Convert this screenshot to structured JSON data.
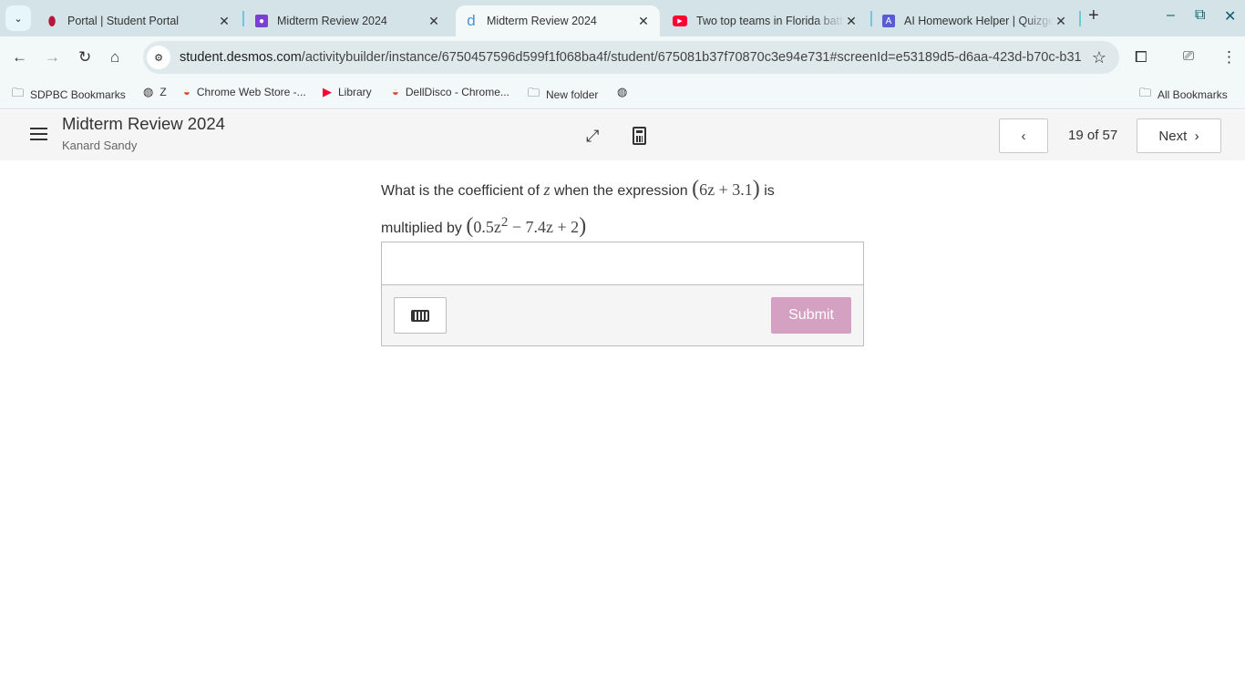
{
  "browser": {
    "tabs": [
      {
        "title": "Portal | Student Portal",
        "icon": "portal-icon",
        "color": "#b4173a"
      },
      {
        "title": "Midterm Review 2024",
        "icon": "classroom-icon",
        "color": "#7b3fd4"
      },
      {
        "title": "Midterm Review 2024",
        "icon": "desmos-icon",
        "color": "#4a90d9",
        "active": true
      },
      {
        "title": "Two top teams in Florida battle",
        "icon": "youtube-icon",
        "color": "#ff0033"
      },
      {
        "title": "AI Homework Helper | Quizgecko",
        "icon": "quizgecko-icon",
        "color": "#5b5bd6"
      }
    ],
    "url_domain": "student.desmos.com",
    "url_path": "/activitybuilder/instance/6750457596d599f1f068ba4f/student/675081b37f70870c3e94e731#screenId=e53189d5-d6aa-423d-b70c-b31…",
    "bookmarks": [
      {
        "label": "SDPBC Bookmarks",
        "icon": "folder-settings-icon"
      },
      {
        "label": "Z",
        "icon": "globe-icon"
      },
      {
        "label": "Chrome Web Store -...",
        "icon": "chrome-web-store-icon"
      },
      {
        "label": "Library",
        "icon": "youtube-icon"
      },
      {
        "label": "DellDisco - Chrome...",
        "icon": "chrome-web-store-icon"
      },
      {
        "label": "New folder",
        "icon": "folder-icon"
      },
      {
        "label": "",
        "icon": "globe-icon"
      }
    ],
    "all_bookmarks": "All Bookmarks"
  },
  "header": {
    "title": "Midterm Review 2024",
    "student": "Kanard Sandy",
    "page": "19 of 57",
    "next": "Next"
  },
  "question": {
    "text1": "What is the coefficient of",
    "var": "z",
    "text2": "when the expression",
    "expr1": "6z + 3.1",
    "text3": "is",
    "text4": "multiplied by",
    "expr2a": "0.5z",
    "expr2sup": "2",
    "expr2b": " − 7.4z + 2"
  },
  "answer": {
    "value": "",
    "submit": "Submit",
    "submit_color": "#d4a1c3"
  }
}
